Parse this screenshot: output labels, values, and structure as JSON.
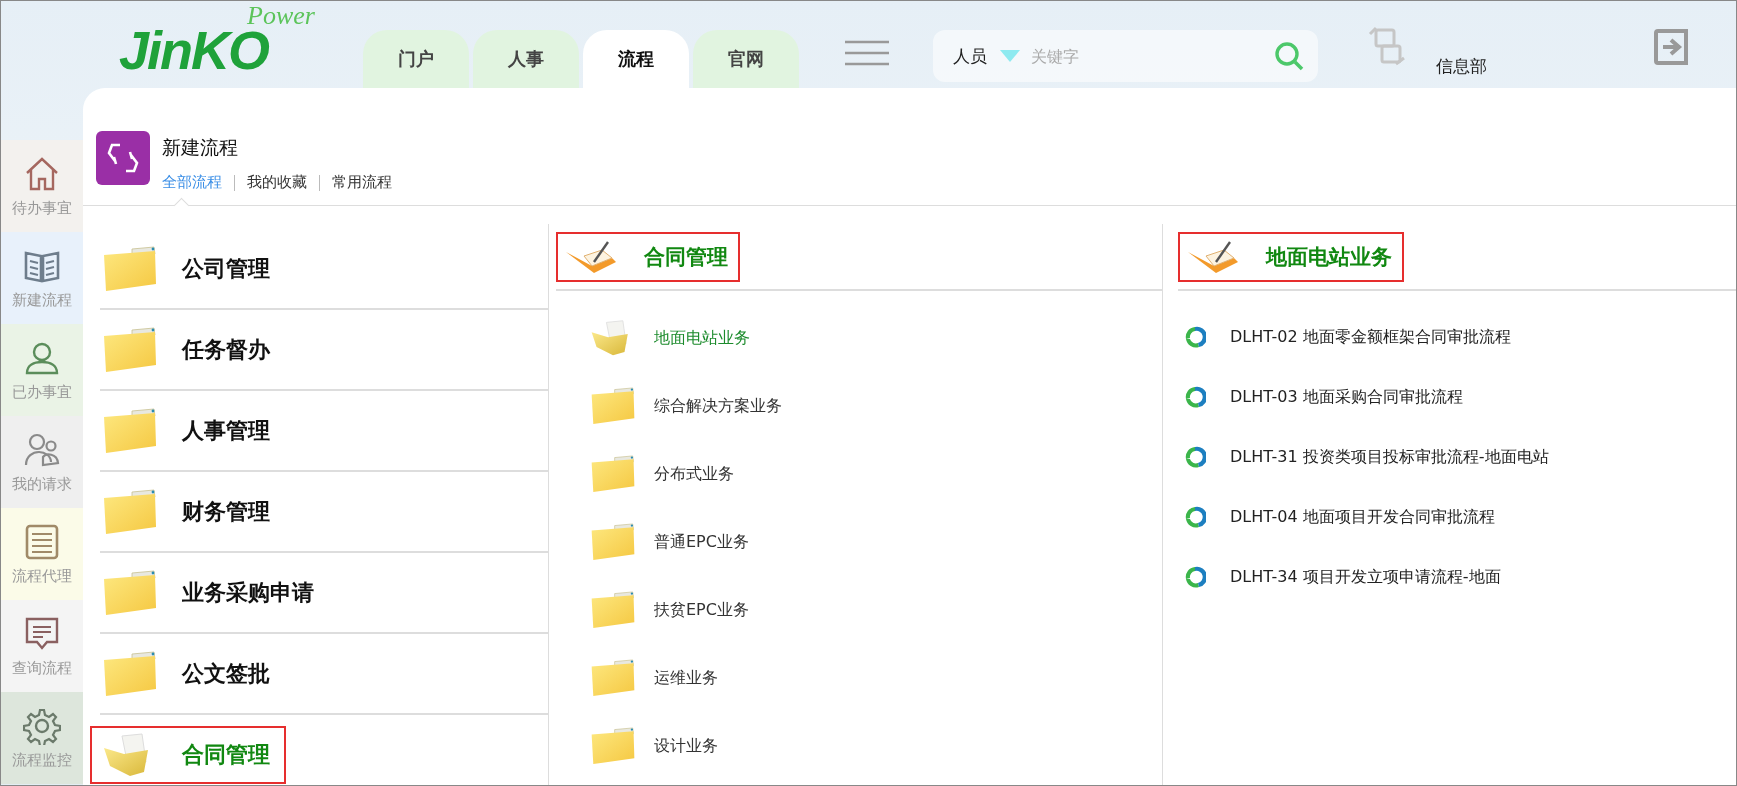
{
  "header": {
    "logo": {
      "brand": "JinKO",
      "tagline": "Power"
    },
    "tabs": [
      {
        "label": "门户",
        "selected": false
      },
      {
        "label": "人事",
        "selected": false
      },
      {
        "label": "流程",
        "selected": true
      },
      {
        "label": "官网",
        "selected": false
      }
    ],
    "search": {
      "scope": "人员",
      "placeholder": "关键字"
    },
    "department": "信息部"
  },
  "sidebar": {
    "items": [
      {
        "label": "待办事宜",
        "color": "#f3f1ee"
      },
      {
        "label": "新建流程",
        "color": "#e8f1fb"
      },
      {
        "label": "已办事宜",
        "color": "#eaf3e6"
      },
      {
        "label": "我的请求",
        "color": "#efefef"
      },
      {
        "label": "流程代理",
        "color": "#fbfbe8"
      },
      {
        "label": "查询流程",
        "color": "#f4f4f4"
      },
      {
        "label": "流程监控",
        "color": "#dde6dc"
      }
    ]
  },
  "panel": {
    "title": "新建流程",
    "links": [
      {
        "label": "全部流程",
        "selected": true
      },
      {
        "label": "我的收藏",
        "selected": false
      },
      {
        "label": "常用流程",
        "selected": false
      }
    ],
    "categories": [
      {
        "label": "公司管理",
        "selected": false,
        "highlighted": false
      },
      {
        "label": "任务督办",
        "selected": false,
        "highlighted": false
      },
      {
        "label": "人事管理",
        "selected": false,
        "highlighted": false
      },
      {
        "label": "财务管理",
        "selected": false,
        "highlighted": false
      },
      {
        "label": "业务采购申请",
        "selected": false,
        "highlighted": false
      },
      {
        "label": "公文签批",
        "selected": false,
        "highlighted": false
      },
      {
        "label": "合同管理",
        "selected": true,
        "highlighted": true
      }
    ],
    "subcategories": {
      "heading": {
        "label": "合同管理",
        "highlighted": true
      },
      "items": [
        {
          "label": "地面电站业务",
          "selected": true
        },
        {
          "label": "综合解决方案业务",
          "selected": false
        },
        {
          "label": "分布式业务",
          "selected": false
        },
        {
          "label": "普通EPC业务",
          "selected": false
        },
        {
          "label": "扶贫EPC业务",
          "selected": false
        },
        {
          "label": "运维业务",
          "selected": false
        },
        {
          "label": "设计业务",
          "selected": false
        }
      ]
    },
    "processes": {
      "heading": {
        "label": "地面电站业务",
        "highlighted": true
      },
      "items": [
        {
          "label": "DLHT-02 地面零金额框架合同审批流程"
        },
        {
          "label": "DLHT-03 地面采购合同审批流程"
        },
        {
          "label": "DLHT-31 投资类项目投标审批流程-地面电站"
        },
        {
          "label": "DLHT-04 地面项目开发合同审批流程"
        },
        {
          "label": "DLHT-34 项目开发立项申请流程-地面"
        }
      ]
    }
  }
}
